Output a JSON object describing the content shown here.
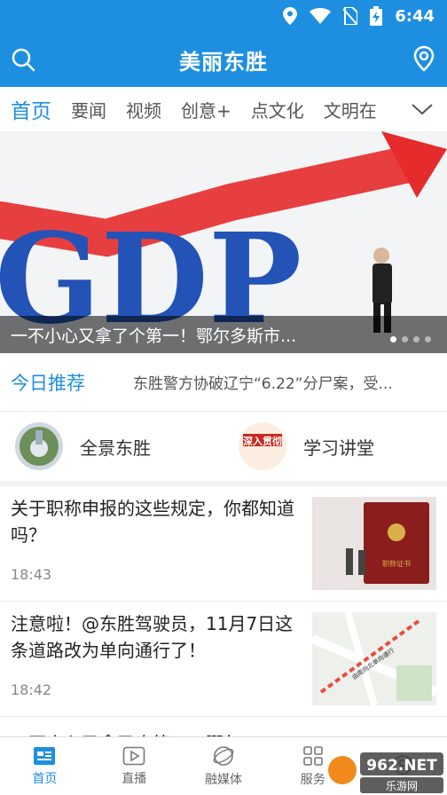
{
  "status_bar": {
    "time": "6:44"
  },
  "header": {
    "title": "美丽东胜"
  },
  "tabs": [
    {
      "label": "首页",
      "active": true
    },
    {
      "label": "要闻"
    },
    {
      "label": "视频"
    },
    {
      "label": "创意+"
    },
    {
      "label": "点文化"
    },
    {
      "label": "文明在"
    }
  ],
  "banner": {
    "image_text": "GDP",
    "caption": "一不小心又拿了个第一！鄂尔多斯市...",
    "slides": 4,
    "active_slide": 1
  },
  "recommend": {
    "label": "今日推荐",
    "text": "东胜警方协破辽宁“6.22”分尸案，受..."
  },
  "shortcuts": [
    {
      "label": "全景东胜",
      "icon": "panorama-icon"
    },
    {
      "label": "学习讲堂",
      "icon": "study-hall-icon",
      "icon_text": "深入贯彻"
    }
  ],
  "news": [
    {
      "headline": "关于职称申报的这些规定，你都知道吗？",
      "time": "18:43",
      "thumb_text": "职称证书"
    },
    {
      "headline": "注意啦！@东胜驾驶员，11月7日这条道路改为单向通行了！",
      "time": "18:42",
      "thumb_text": "由南向北单向通行"
    },
    {
      "headline": "一不小心又拿了个第一！鄂尔"
    }
  ],
  "bottom_nav": [
    {
      "label": "首页",
      "icon": "home-icon",
      "active": true
    },
    {
      "label": "直播",
      "icon": "live-icon"
    },
    {
      "label": "融媒体",
      "icon": "media-icon"
    },
    {
      "label": "服务",
      "icon": "services-icon"
    },
    {
      "label": "",
      "icon": "profile-icon"
    }
  ],
  "watermark": {
    "text": "962.NET",
    "subtext": "乐游网"
  },
  "colors": {
    "accent": "#1e8fe0",
    "text": "#222222",
    "muted": "#888888"
  }
}
